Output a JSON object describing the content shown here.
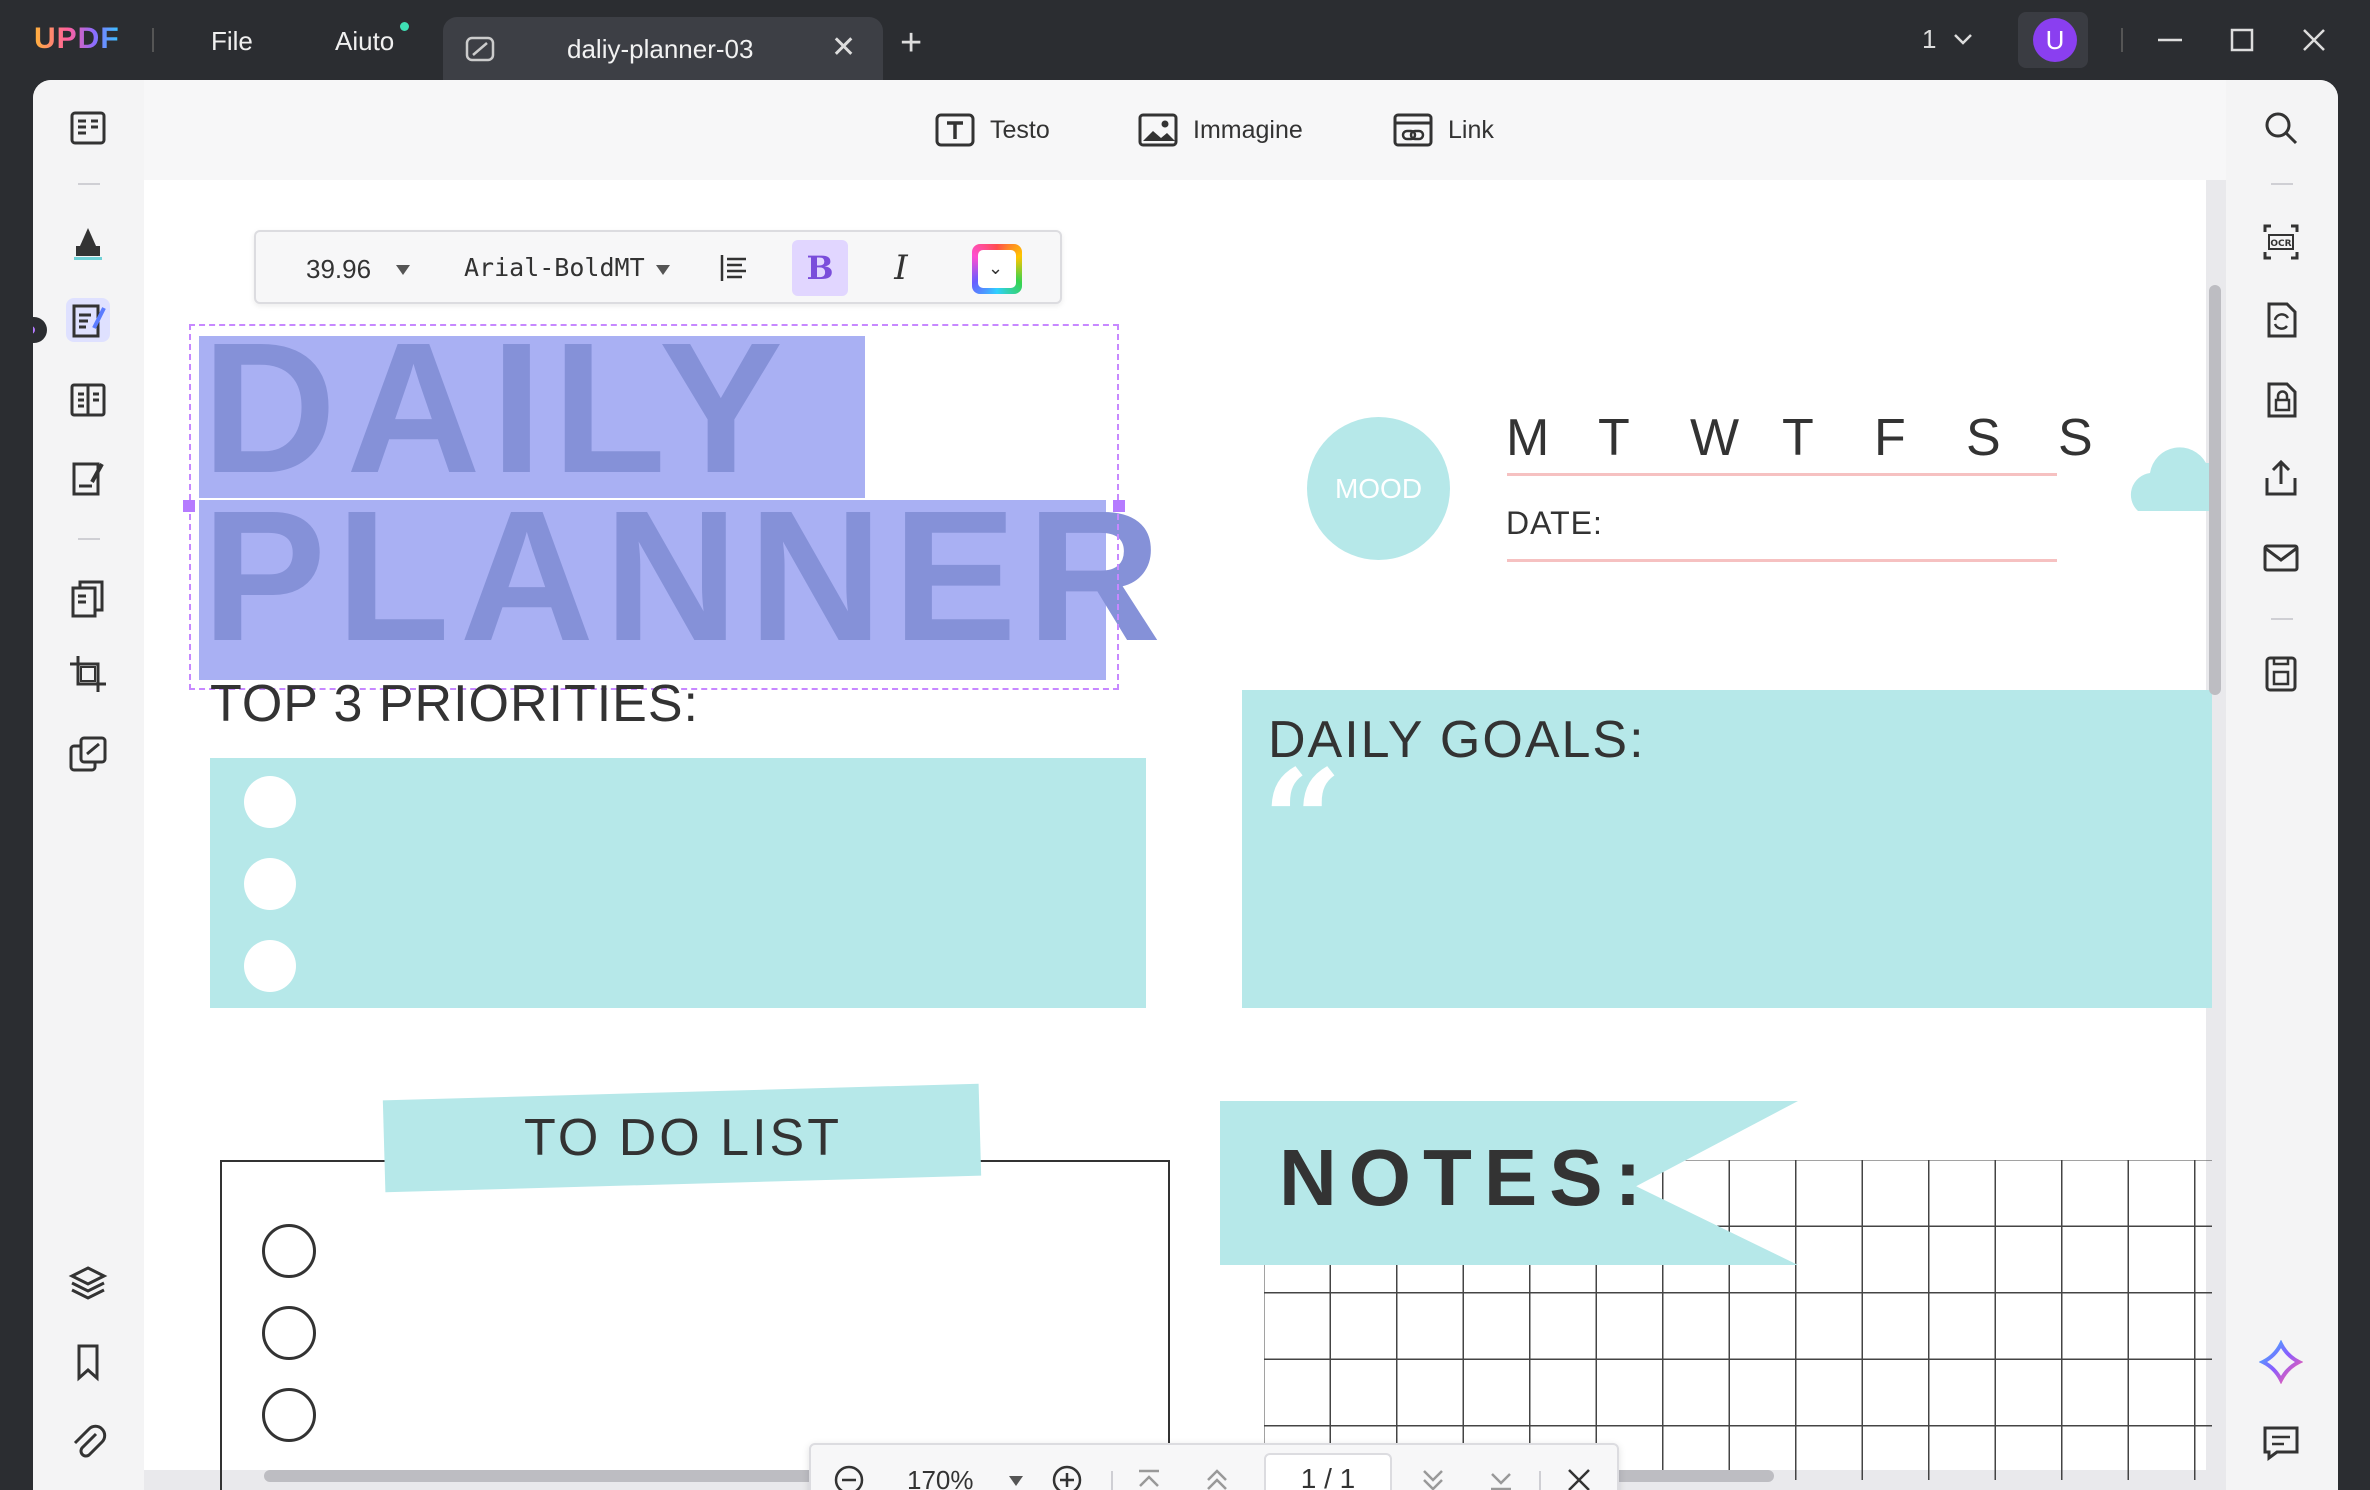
{
  "app": {
    "logo": "UPDF",
    "menu": [
      "File",
      "Aiuto"
    ]
  },
  "tab": {
    "title": "daliy-planner-03",
    "close": "✕",
    "new": "+"
  },
  "titlebar": {
    "page_indicator": "1",
    "avatar_letter": "U"
  },
  "toolbar": {
    "text": "Testo",
    "image": "Immagine",
    "link": "Link"
  },
  "format": {
    "font_size": "39.96",
    "font_name": "Arial-BoldMT",
    "bold": "B",
    "italic": "I"
  },
  "page": {
    "title_line1": "DAILY",
    "title_line2": "PLANNER",
    "priorities_title": "TOP 3 PRIORITIES:",
    "mood": "MOOD",
    "days": [
      "M",
      "T",
      "W",
      "T",
      "F",
      "S",
      "S"
    ],
    "date_label": "DATE:",
    "goals_title": "DAILY GOALS:",
    "quote_mark": "“",
    "todo_title": "TO DO LIST",
    "notes_title": "NOTES:"
  },
  "zoombar": {
    "zoom": "170%",
    "page": "1 / 1"
  },
  "colors": {
    "accent": "#8a3ff0",
    "teal": "#b6e8e9",
    "highlight": "#a9b0f3",
    "pink_line": "#f6c1c1"
  }
}
